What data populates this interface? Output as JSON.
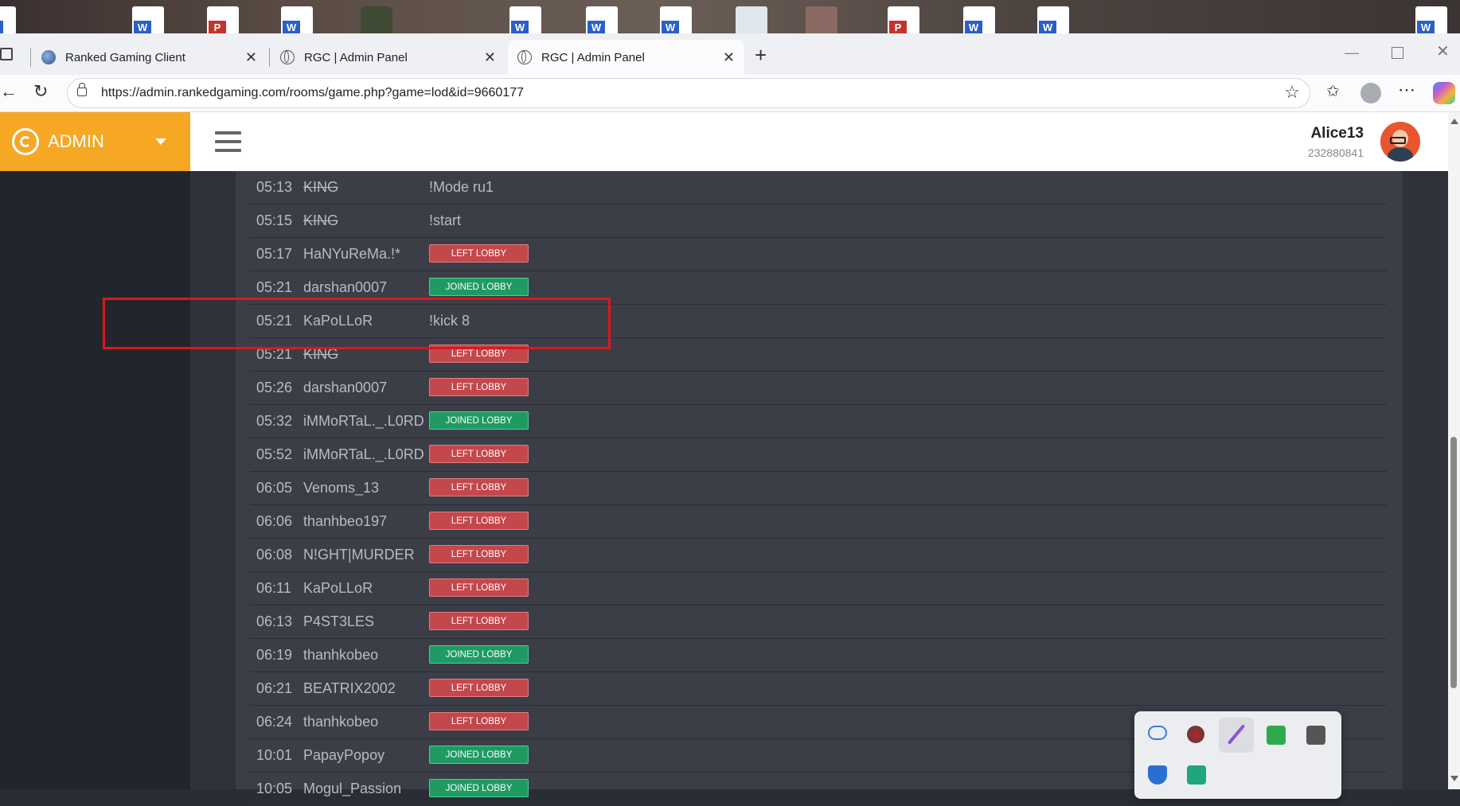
{
  "browser": {
    "tabs": [
      {
        "title": "Ranked Gaming Client",
        "active": false
      },
      {
        "title": "RGC | Admin Panel",
        "active": false
      },
      {
        "title": "RGC | Admin Panel",
        "active": true
      }
    ],
    "url": "https://admin.rankedgaming.com/rooms/game.php?game=lod&id=9660177"
  },
  "app": {
    "brand": "ADMIN",
    "accent_color": "#f6a724",
    "user": {
      "name": "Alice13",
      "id": "232880841"
    }
  },
  "log": [
    {
      "time": "05:13",
      "user": "KING",
      "strike": true,
      "message": "!Mode ru1"
    },
    {
      "time": "05:15",
      "user": "KING",
      "strike": true,
      "message": "!start"
    },
    {
      "time": "05:17",
      "user": "HaNYuReMa.!*",
      "badge": "left",
      "badge_label": "LEFT LOBBY"
    },
    {
      "time": "05:21",
      "user": "darshan0007",
      "badge": "joined",
      "badge_label": "JOINED LOBBY"
    },
    {
      "time": "05:21",
      "user": "KaPoLLoR",
      "message": "!kick 8",
      "highlighted": true
    },
    {
      "time": "05:21",
      "user": "KING",
      "strike": true,
      "badge": "left",
      "badge_label": "LEFT LOBBY"
    },
    {
      "time": "05:26",
      "user": "darshan0007",
      "badge": "left",
      "badge_label": "LEFT LOBBY"
    },
    {
      "time": "05:32",
      "user": "iMMoRTaL._.L0RD",
      "badge": "joined",
      "badge_label": "JOINED LOBBY"
    },
    {
      "time": "05:52",
      "user": "iMMoRTaL._.L0RD",
      "badge": "left",
      "badge_label": "LEFT LOBBY"
    },
    {
      "time": "06:05",
      "user": "Venoms_13",
      "badge": "left",
      "badge_label": "LEFT LOBBY"
    },
    {
      "time": "06:06",
      "user": "thanhbeo197",
      "badge": "left",
      "badge_label": "LEFT LOBBY"
    },
    {
      "time": "06:08",
      "user": "N!GHT|MURDER",
      "badge": "left",
      "badge_label": "LEFT LOBBY"
    },
    {
      "time": "06:11",
      "user": "KaPoLLoR",
      "badge": "left",
      "badge_label": "LEFT LOBBY"
    },
    {
      "time": "06:13",
      "user": "P4ST3LES",
      "badge": "left",
      "badge_label": "LEFT LOBBY"
    },
    {
      "time": "06:19",
      "user": "thanhkobeo",
      "badge": "joined",
      "badge_label": "JOINED LOBBY"
    },
    {
      "time": "06:21",
      "user": "BEATRIX2002",
      "badge": "left",
      "badge_label": "LEFT LOBBY"
    },
    {
      "time": "06:24",
      "user": "thanhkobeo",
      "badge": "left",
      "badge_label": "LEFT LOBBY"
    },
    {
      "time": "10:01",
      "user": "PapayPopoy",
      "badge": "joined",
      "badge_label": "JOINED LOBBY"
    },
    {
      "time": "10:05",
      "user": "Mogul_Passion",
      "badge": "joined",
      "badge_label": "JOINED LOBBY"
    }
  ],
  "colors": {
    "left_lobby": "#c4474c",
    "joined_lobby": "#1f9a63",
    "highlight_box": "#e0161a"
  },
  "tray_icons": [
    "onedrive-icon",
    "record-icon",
    "pen-icon",
    "h-app-icon",
    "network-tool-icon",
    "security-icon",
    "app-icon"
  ]
}
